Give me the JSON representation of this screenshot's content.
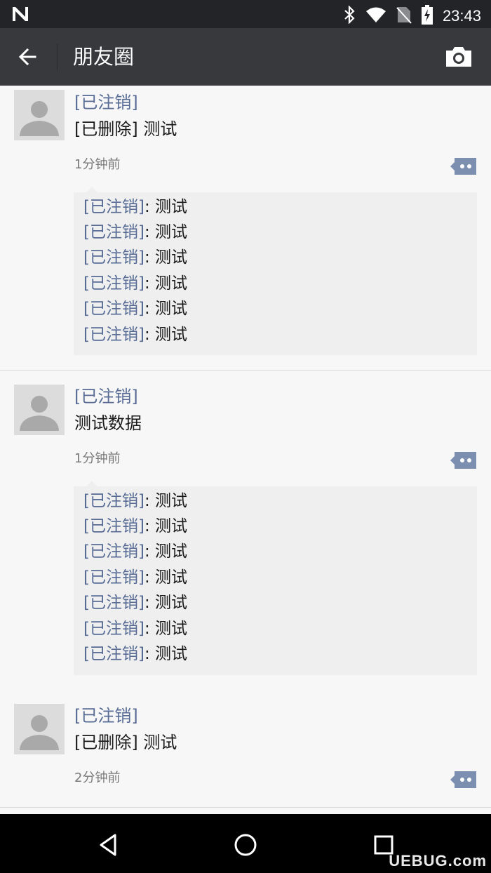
{
  "status_bar": {
    "time": "23:43",
    "icons": [
      "n-icon",
      "bluetooth-icon",
      "wifi-icon",
      "no-sim-icon",
      "battery-charging-icon"
    ]
  },
  "app_bar": {
    "title": "朋友圈",
    "back_icon": "arrow-left-icon",
    "camera_icon": "camera-icon"
  },
  "posts": [
    {
      "name": "[已注销]",
      "content": "[已删除] 测试",
      "time": "1分钟前",
      "comments": [
        {
          "author": "[已注销]",
          "sep": ":",
          "text": " 测试"
        },
        {
          "author": "[已注销]",
          "sep": ":",
          "text": " 测试"
        },
        {
          "author": "[已注销]",
          "sep": ":",
          "text": " 测试"
        },
        {
          "author": "[已注销]",
          "sep": ":",
          "text": " 测试"
        },
        {
          "author": "[已注销]",
          "sep": ":",
          "text": " 测试"
        },
        {
          "author": "[已注销]",
          "sep": ":",
          "text": " 测试"
        }
      ]
    },
    {
      "name": "[已注销]",
      "content": "测试数据",
      "time": "1分钟前",
      "comments": [
        {
          "author": "[已注销]",
          "sep": ":",
          "text": " 测试"
        },
        {
          "author": "[已注销]",
          "sep": ":",
          "text": " 测试"
        },
        {
          "author": "[已注销]",
          "sep": ":",
          "text": " 测试"
        },
        {
          "author": "[已注销]",
          "sep": ":",
          "text": " 测试"
        },
        {
          "author": "[已注销]",
          "sep": ":",
          "text": " 测试"
        },
        {
          "author": "[已注销]",
          "sep": ":",
          "text": " 测试"
        },
        {
          "author": "[已注销]",
          "sep": ":",
          "text": " 测试"
        }
      ]
    },
    {
      "name": "[已注销]",
      "content": "[已删除] 测试",
      "time": "2分钟前",
      "comments": []
    }
  ],
  "nav_bar": {
    "icons": [
      "back-triangle-icon",
      "home-circle-icon",
      "recents-square-icon"
    ]
  },
  "watermark": "UEBUG.com",
  "colors": {
    "status_bar": "#232427",
    "app_bar": "#38393d",
    "name_link": "#576b95",
    "comment_bg": "#efefef",
    "comment_button": "#7d8fb0",
    "background": "#f7f7f7"
  }
}
